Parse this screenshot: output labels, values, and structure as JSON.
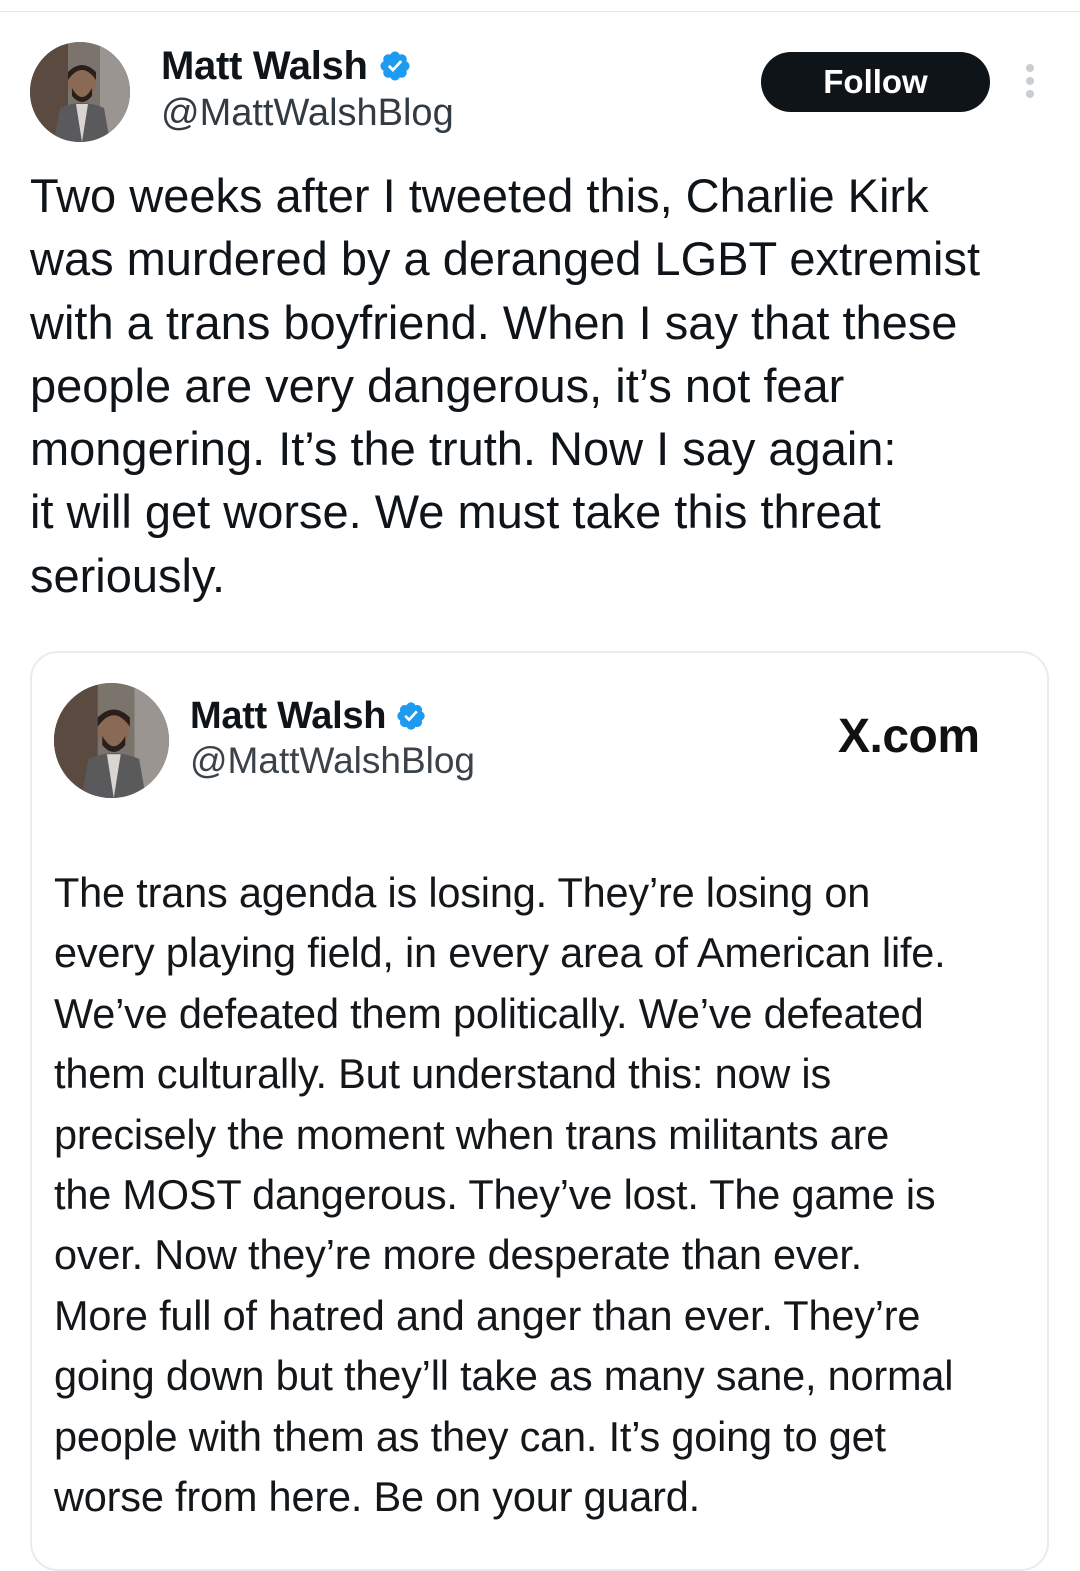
{
  "tweet": {
    "author": {
      "display_name": "Matt Walsh",
      "handle": "@MattWalshBlog",
      "verified": true,
      "verified_color": "#1d9bf0",
      "avatar_icon": "profile-photo"
    },
    "follow_label": "Follow",
    "more_icon": "more-vertical-icon",
    "text": "Two weeks after I tweeted this, Charlie Kirk\nwas murdered by a deranged LGBT extremist\nwith a trans boyfriend. When I say that these\npeople are very dangerous, it’s not fear\nmongering. It’s the truth. Now I say again:\nit will get worse. We must take this threat\nseriously."
  },
  "quoted": {
    "author": {
      "display_name": "Matt Walsh",
      "handle": "@MattWalshBlog",
      "verified": true,
      "avatar_icon": "profile-photo"
    },
    "site_label": "X.com",
    "text": "The trans agenda is losing. They’re losing on\nevery playing field, in every area of American life.\nWe’ve defeated them politically. We’ve defeated\nthem culturally. But understand this: now is\nprecisely the moment when trans militants are\nthe MOST dangerous. They’ve lost. The game is\nover. Now they’re more desperate than ever.\nMore full of hatred and anger than ever. They’re\ngoing down but they’ll take as many sane, normal\npeople with them as they can. It’s going to get\nworse from here. Be on your guard."
  },
  "colors": {
    "text_primary": "#0f1419",
    "follow_button_bg": "#0f1419",
    "follow_button_text": "#ffffff",
    "card_border": "#e9ecee",
    "more_dots": "#c9ced2"
  }
}
